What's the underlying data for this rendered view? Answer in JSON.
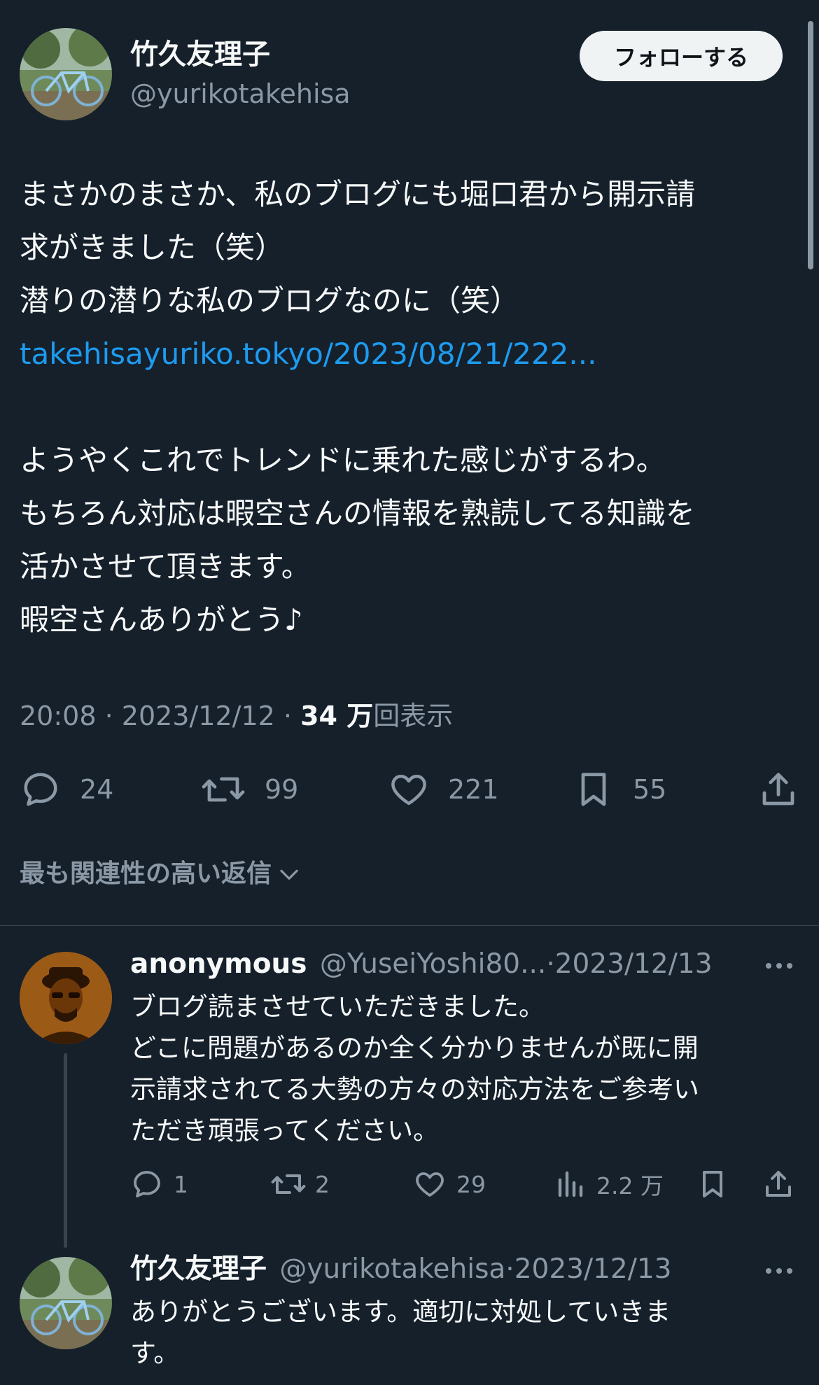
{
  "colors": {
    "background": "#15202b",
    "text": "#f7f9f9",
    "muted": "#8b98a5",
    "link": "#1d9bf0",
    "follow_button_bg": "#eff3f4"
  },
  "tweet": {
    "author_name": "竹久友理子",
    "author_handle": "@yurikotakehisa",
    "follow_label": "フォローする",
    "lines": [
      "まさかのまさか、私のブログにも堀口君から開示請",
      "求がきました（笑）",
      "潜りの潜りな私のブログなのに（笑）"
    ],
    "link": "takehisayuriko.tokyo/2023/08/21/222...",
    "lines2": [
      "ようやくこれでトレンドに乗れた感じがするわ。",
      "もちろん対応は暇空さんの情報を熟読してる知識を",
      "活かさせて頂きます。",
      "暇空さんありがとう♪"
    ],
    "time": "20:08",
    "date": "2023/12/12",
    "views_number": "34 万",
    "views_label": "回表示",
    "counts": {
      "replies": "24",
      "retweets": "99",
      "likes": "221",
      "bookmarks": "55"
    }
  },
  "sort_label": "最も関連性の高い返信",
  "replies": [
    {
      "author_name": "anonymous",
      "author_handle": "@YuseiYoshi80...",
      "date": "2023/12/13",
      "lines": [
        "ブログ読まさせていただきました。",
        "どこに問題があるのか全く分かりませんが既に開",
        "示請求されてる大勢の方々の対応方法をご参考い",
        "ただき頑張ってください。"
      ],
      "counts": {
        "replies": "1",
        "retweets": "2",
        "likes": "29",
        "views": "2.2 万"
      }
    },
    {
      "author_name": "竹久友理子",
      "author_handle": "@yurikotakehisa",
      "date": "2023/12/13",
      "lines": [
        "ありがとうございます。適切に対処していきま",
        "す。"
      ]
    }
  ],
  "icons": {
    "reply": "speech-bubble-icon",
    "retweet": "retweet-icon",
    "like": "heart-icon",
    "bookmark": "bookmark-icon",
    "share": "share-icon",
    "views": "bar-chart-icon",
    "more": "more-dots-icon",
    "chevron": "chevron-down-icon"
  }
}
